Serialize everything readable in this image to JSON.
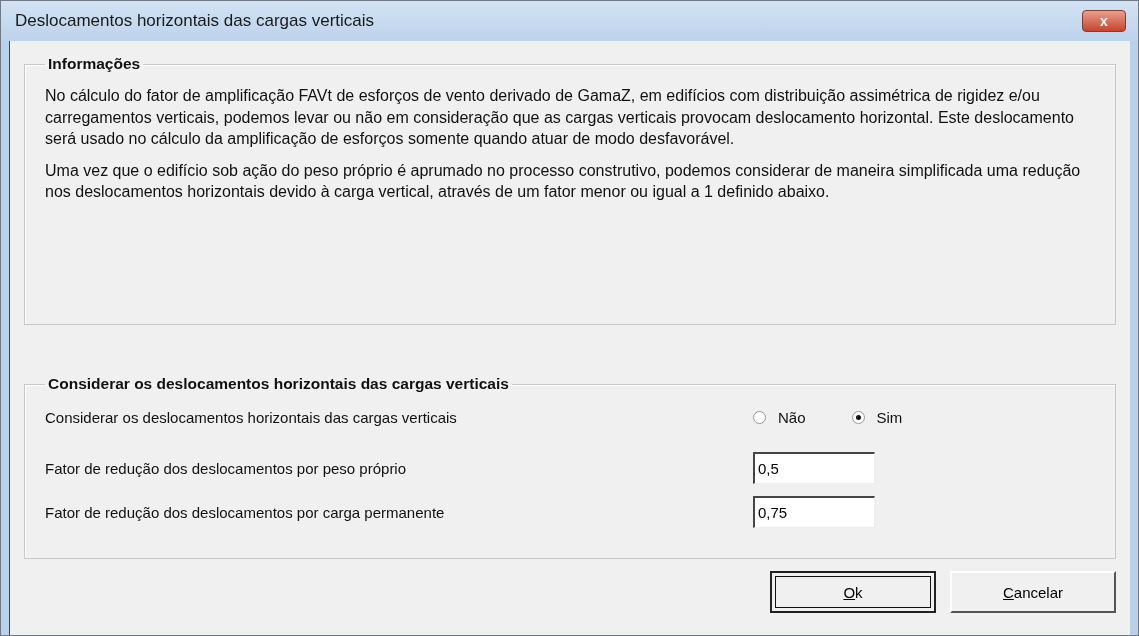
{
  "window": {
    "title": "Deslocamentos horizontais das cargas verticais",
    "close_label": "x"
  },
  "info": {
    "title": "Informações",
    "paragraphs": [
      "No cálculo do fator de amplificação FAVt de esforços de vento derivado de GamaZ, em edifícios com distribuição assimétrica de rigidez e/ou carregamentos verticais, podemos levar ou não em consideração que as cargas verticais provocam deslocamento horizontal. Este deslocamento será usado no cálculo da amplificação de esforços somente quando atuar de modo desfavorável.",
      "Uma vez que o edifício sob ação do peso próprio é aprumado no processo construtivo, podemos considerar de maneira simplificada uma redução nos deslocamentos horizontais devido à carga vertical, através de um fator menor ou igual a 1 definido abaixo."
    ]
  },
  "options": {
    "title": "Considerar os deslocamentos horizontais das cargas verticais",
    "rows": [
      {
        "kind": "radio",
        "label": "Considerar os deslocamentos horizontais das cargas verticais",
        "choices": [
          {
            "label": "Não",
            "selected": false
          },
          {
            "label": "Sim",
            "selected": true
          }
        ]
      },
      {
        "kind": "field",
        "label": "Fator de redução dos deslocamentos por peso próprio",
        "value": "0,5"
      },
      {
        "kind": "field",
        "label": "Fator de redução dos deslocamentos por carga permanente",
        "value": "0,75"
      }
    ]
  },
  "buttons": [
    {
      "label": "Ok",
      "default": true
    },
    {
      "label": "Cancelar",
      "default": false
    }
  ]
}
